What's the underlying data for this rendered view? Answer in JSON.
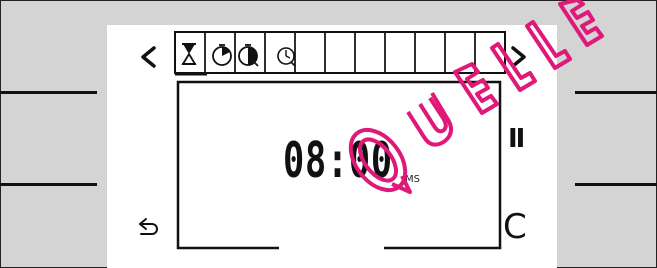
{
  "display": {
    "time_value": "08:00",
    "time_unit": "MS",
    "pause_label": "II",
    "clear_label": "C"
  },
  "tabs": [
    {
      "icon": "hourglass-icon",
      "active": true
    },
    {
      "icon": "timer-start-icon",
      "active": false
    },
    {
      "icon": "timer-end-icon",
      "active": false
    },
    {
      "icon": "clock-icon",
      "active": false
    },
    {
      "icon": "",
      "active": false
    },
    {
      "icon": "",
      "active": false
    },
    {
      "icon": "",
      "active": false
    },
    {
      "icon": "",
      "active": false
    },
    {
      "icon": "",
      "active": false
    },
    {
      "icon": "",
      "active": false
    },
    {
      "icon": "",
      "active": false
    }
  ],
  "watermark": "QUELLE",
  "colors": {
    "background": "#d4d4d4",
    "panel": "#ffffff",
    "ink": "#111111",
    "watermark": "#e0187a"
  }
}
